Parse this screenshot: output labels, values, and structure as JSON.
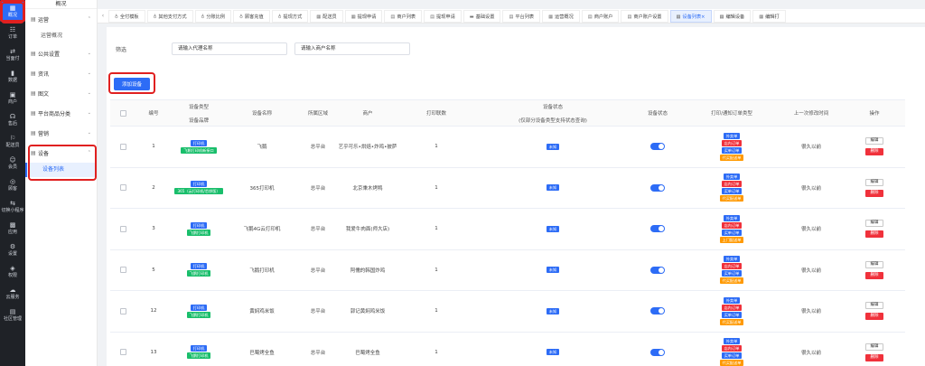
{
  "rail": [
    {
      "label": "概况",
      "icon": "dashboard-icon",
      "glyph": "▦"
    },
    {
      "label": "订单",
      "icon": "order-icon",
      "glyph": "☷"
    },
    {
      "label": "当面付",
      "icon": "pay-icon",
      "glyph": "⇄"
    },
    {
      "label": "数据",
      "icon": "chart-icon",
      "glyph": "▮"
    },
    {
      "label": "商户",
      "icon": "shop-icon",
      "glyph": "▣"
    },
    {
      "label": "售后",
      "icon": "headset-icon",
      "glyph": "☊"
    },
    {
      "label": "配送员",
      "icon": "courier-icon",
      "glyph": "⚐"
    },
    {
      "label": "会员",
      "icon": "member-icon",
      "glyph": "☺"
    },
    {
      "label": "顾客",
      "icon": "customer-icon",
      "glyph": "◎"
    },
    {
      "label": "切换小程序",
      "icon": "switch-icon",
      "glyph": "⇆"
    },
    {
      "label": "应用",
      "icon": "apps-icon",
      "glyph": "▩"
    },
    {
      "label": "设置",
      "icon": "settings-icon",
      "glyph": "⚙"
    },
    {
      "label": "权限",
      "icon": "permission-icon",
      "glyph": "◈"
    },
    {
      "label": "云服务",
      "icon": "cloud-icon",
      "glyph": "☁"
    },
    {
      "label": "社区管理",
      "icon": "community-icon",
      "glyph": "▤"
    }
  ],
  "sidebar": {
    "header": "概况",
    "groups": [
      {
        "label": "运营",
        "icon": "operations-icon",
        "glyph": "▤",
        "chev": "⌃"
      },
      {
        "sub": "运营概况"
      },
      {
        "label": "公共设置",
        "icon": "common-settings-icon",
        "glyph": "▤",
        "chev": "⌄"
      },
      {
        "label": "资讯",
        "icon": "news-icon",
        "glyph": "▤",
        "chev": "⌄"
      },
      {
        "label": "图文",
        "icon": "article-icon",
        "glyph": "▤",
        "chev": "⌄"
      },
      {
        "label": "平台商品分类",
        "icon": "category-icon",
        "glyph": "▤",
        "chev": "⌄"
      },
      {
        "label": "营销",
        "icon": "marketing-icon",
        "glyph": "▤",
        "chev": "⌄"
      },
      {
        "label": "设备",
        "icon": "device-icon",
        "glyph": "▤",
        "chev": "⌃"
      },
      {
        "sub": "设备列表",
        "active": true
      }
    ]
  },
  "tabs": [
    {
      "label": "全付模板",
      "glyph": "♁"
    },
    {
      "label": "其他支付方式",
      "glyph": "♁"
    },
    {
      "label": "分账比例",
      "glyph": "♁"
    },
    {
      "label": "顾客充值",
      "glyph": "♁"
    },
    {
      "label": "提现方式",
      "glyph": "♁"
    },
    {
      "label": "配送员",
      "glyph": "▦"
    },
    {
      "label": "提现申请",
      "glyph": "▦"
    },
    {
      "label": "商户列表",
      "glyph": "▤"
    },
    {
      "label": "提现申请",
      "glyph": "▤"
    },
    {
      "label": "基础设置",
      "glyph": "▬"
    },
    {
      "label": "平台列表",
      "glyph": "▤"
    },
    {
      "label": "运营概况",
      "glyph": "▦"
    },
    {
      "label": "商户账户",
      "glyph": "▤"
    },
    {
      "label": "商户账户设置",
      "glyph": "▤"
    },
    {
      "label": "设备列表",
      "glyph": "▦",
      "active": true,
      "close": "×"
    },
    {
      "label": "编辑设备",
      "glyph": "▦"
    },
    {
      "label": "编辑打",
      "glyph": "▦"
    }
  ],
  "filter": {
    "label": "筛选",
    "agent_placeholder": "请输入代理名称",
    "shop_placeholder": "请输入商户名称"
  },
  "add_button": "添加设备",
  "table": {
    "headers": {
      "no": "编号",
      "type": "设备类型",
      "brand": "设备品牌",
      "name": "设备名称",
      "area": "所属区域",
      "shop": "商户",
      "copies": "打印联数",
      "status": "设备状态",
      "status_note": "(仅部分设备类型支持状态查询)",
      "switch": "设备状态",
      "print_types": "打印/通知订单类型",
      "last_modified": "上一次修改时间",
      "op": "操作"
    },
    "rows": [
      {
        "no": "1",
        "type": "打印机",
        "brand": "飞鹅打印机新接口",
        "name": "飞鹅",
        "area": "总平台",
        "shop": "艺乎可乐•烘焙•炸鸡•披萨",
        "copies": "1",
        "status": "未知",
        "time": "很久以前",
        "print": [
          "外卖单",
          "店内订单",
          "买单订单",
          "代买配送单"
        ]
      },
      {
        "no": "2",
        "type": "打印机",
        "brand": "365（云打印机/芯烨版）",
        "name": "365打印机",
        "area": "总平台",
        "shop": "北京秉木烤鸭",
        "copies": "1",
        "status": "未知",
        "time": "很久以前",
        "print": [
          "外卖单",
          "店内订单",
          "买单订单",
          "代买配送单"
        ]
      },
      {
        "no": "3",
        "type": "打印机",
        "brand": "飞鹅打印机",
        "name": "飞鹅4G云打印机",
        "area": "总平台",
        "shop": "我爱牛肉面(师大店)",
        "copies": "1",
        "status": "未知",
        "time": "很久以前",
        "print": [
          "外卖单",
          "店内订单",
          "买单订单",
          "上门配送单"
        ]
      },
      {
        "no": "5",
        "type": "打印机",
        "brand": "飞鹅打印机",
        "name": "飞鹅打印机",
        "area": "总平台",
        "shop": "阿儒的韩国炸鸡",
        "copies": "1",
        "status": "未知",
        "time": "很久以前",
        "print": [
          "外卖单",
          "店内订单",
          "买单订单",
          "代买配送单"
        ]
      },
      {
        "no": "12",
        "type": "打印机",
        "brand": "飞鹅打印机",
        "name": "黄焖鸡米饭",
        "area": "总平台",
        "shop": "郭记黄焖鸡米饭",
        "copies": "1",
        "status": "未知",
        "time": "很久以前",
        "print": [
          "外卖单",
          "店内订单",
          "买单订单",
          "代买配送单"
        ]
      },
      {
        "no": "13",
        "type": "打印机",
        "brand": "飞鹅打印机",
        "name": "巴蜀烤全鱼",
        "area": "总平台",
        "shop": "巴蜀烤全鱼",
        "copies": "1",
        "status": "未知",
        "time": "很久以前",
        "print": [
          "外卖单",
          "店内订单",
          "买单订单",
          "代买配送单"
        ]
      }
    ],
    "edit_label": "编辑",
    "delete_label": "删除"
  },
  "colors": {
    "accent": "#2d6cf6",
    "danger": "#f0313b",
    "success": "#19be6b",
    "warning": "#ff9900",
    "highlight": "#e02020"
  }
}
